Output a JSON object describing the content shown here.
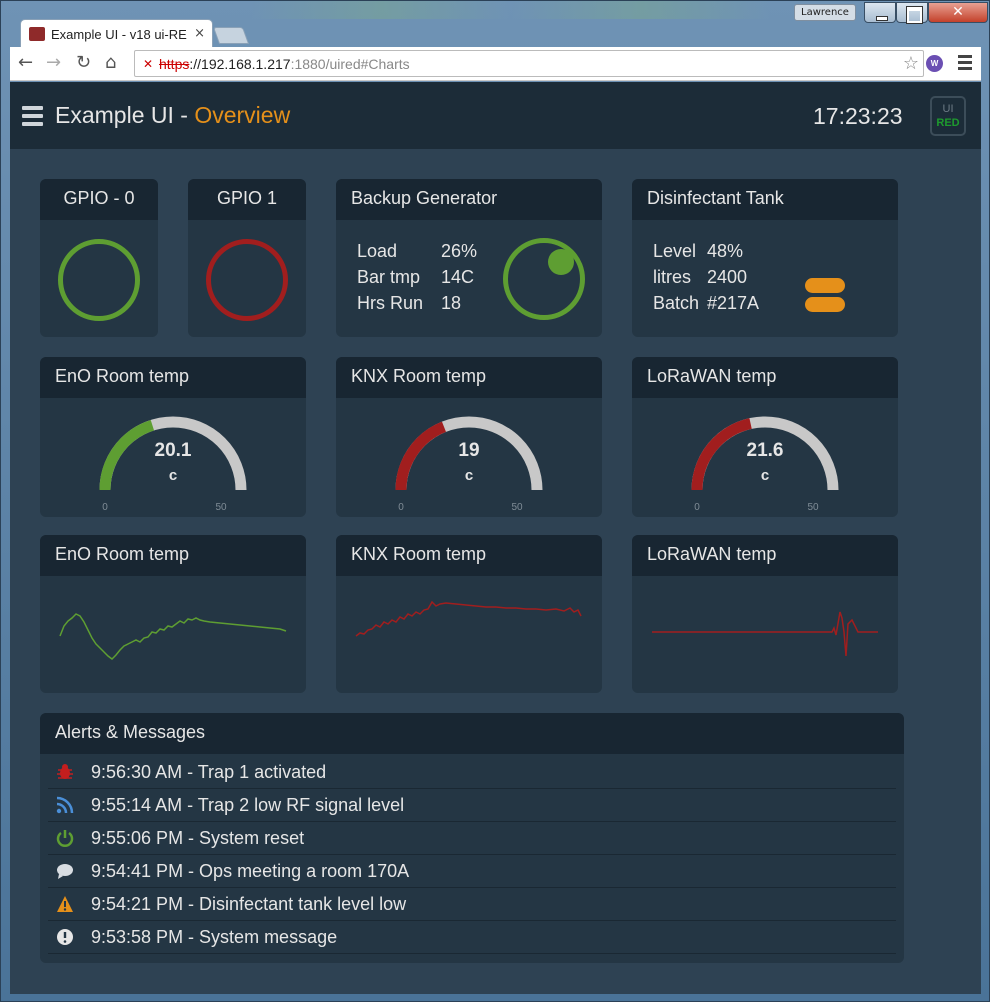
{
  "browser": {
    "tab_title": "Example UI - v18 ui-RE",
    "tab_close": "×",
    "user_badge": "Lawrence",
    "url_scheme": "https",
    "url_host": "://192.168.1.217",
    "url_rest": ":1880/uired#Charts",
    "ext_icon": "W"
  },
  "header": {
    "app_title": "Example UI - ",
    "page_title": "Overview",
    "clock": "17:23:23",
    "badge_top": "UI",
    "badge_bottom": "RED"
  },
  "colors": {
    "green": "#5e9e32",
    "red": "#a11e1e",
    "orange": "#e5901a",
    "gauge_track": "#c8c8c8"
  },
  "gpio0": {
    "title": "GPIO - 0",
    "state": "on"
  },
  "gpio1": {
    "title": "GPIO 1",
    "state": "off"
  },
  "generator": {
    "title": "Backup Generator",
    "rows": [
      {
        "label": "Load",
        "value": "26%"
      },
      {
        "label": "Bar tmp",
        "value": "14C"
      },
      {
        "label": "Hrs Run",
        "value": "18"
      }
    ]
  },
  "tank": {
    "title": "Disinfectant Tank",
    "rows": [
      {
        "label": "Level",
        "value": "48%"
      },
      {
        "label": "litres",
        "value": "2400"
      },
      {
        "label": "Batch",
        "value": "#217A"
      }
    ]
  },
  "gauges": [
    {
      "title": "EnO Room temp",
      "value": "20.1",
      "numeric": 20.1,
      "units": "c",
      "min": "0",
      "max": "50",
      "color": "#5e9e32"
    },
    {
      "title": "KNX Room temp",
      "value": "19",
      "numeric": 19,
      "units": "c",
      "min": "0",
      "max": "50",
      "color": "#a11e1e"
    },
    {
      "title": "LoRaWAN temp",
      "value": "21.6",
      "numeric": 21.6,
      "units": "c",
      "min": "0",
      "max": "50",
      "color": "#a11e1e"
    }
  ],
  "charts": [
    {
      "title": "EnO Room temp",
      "color": "#5e9e32"
    },
    {
      "title": "KNX Room temp",
      "color": "#a11e1e"
    },
    {
      "title": "LoRaWAN temp",
      "color": "#a11e1e"
    }
  ],
  "alerts": {
    "title": "Alerts & Messages",
    "items": [
      {
        "icon": "bug-icon",
        "text": "9:56:30 AM - Trap 1 activated"
      },
      {
        "icon": "rss-icon",
        "text": "9:55:14 AM - Trap 2 low RF signal level"
      },
      {
        "icon": "power-icon",
        "text": "9:55:06 PM - System reset"
      },
      {
        "icon": "comment-icon",
        "text": "9:54:41 PM - Ops meeting a room 170A"
      },
      {
        "icon": "warning-icon",
        "text": "9:54:21 PM - Disinfectant tank level low"
      },
      {
        "icon": "info-icon",
        "text": "9:53:58 PM - System message"
      }
    ]
  }
}
